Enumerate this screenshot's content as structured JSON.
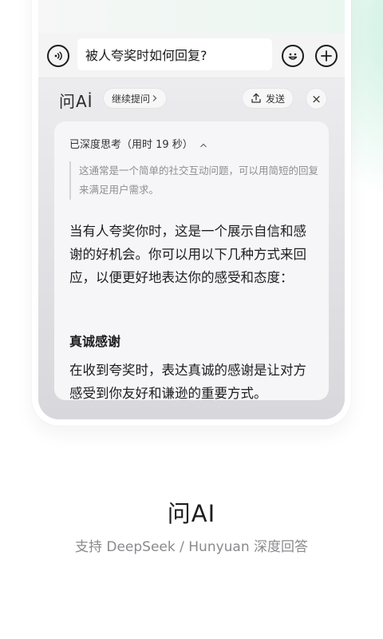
{
  "input": {
    "question": "被人夸奖时如何回复?"
  },
  "panel": {
    "logo": "问Aİ",
    "continue_label": "继续提问",
    "send_label": "发送",
    "close_label": "×"
  },
  "card": {
    "think_header": "已深度思考（用时 19 秒）",
    "think_text": "这通常是一个简单的社交互动问题，可以用简短的回复来满足用户需求。",
    "answer": "当有人夸奖你时，这是一个展示自信和感谢的好机会。你可以用以下几种方式来回应，以便更好地表达你的感受和态度：",
    "subhead": "真诚感谢",
    "detail": "在收到夸奖时，表达真诚的感谢是让对方感受到你友好和谦逊的重要方式。"
  },
  "caption": {
    "title": "问AI",
    "subtitle": "支持 DeepSeek / Hunyuan 深度回答"
  },
  "icons": {
    "voice": "voice-icon",
    "emoji": "emoji-icon",
    "plus": "plus-icon",
    "share": "share-icon",
    "chevron_right": "chevron-right-icon",
    "chevron_up": "chevron-up-icon"
  }
}
